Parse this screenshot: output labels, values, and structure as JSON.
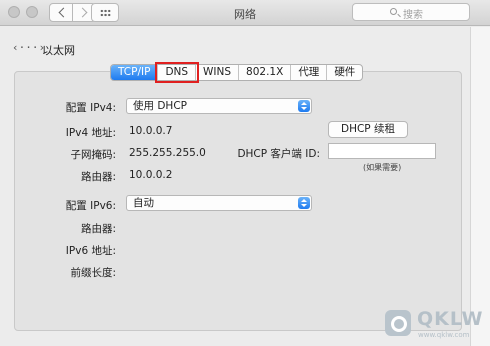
{
  "window": {
    "title": "网络"
  },
  "search": {
    "placeholder": "搜索"
  },
  "interface": {
    "name": "以太网",
    "icon": "ethernet-arrows-icon",
    "icon_glyph": "‹···›"
  },
  "tabs": [
    {
      "label": "TCP/IP",
      "active": true
    },
    {
      "label": "DNS",
      "highlighted": true
    },
    {
      "label": "WINS"
    },
    {
      "label": "802.1X"
    },
    {
      "label": "代理"
    },
    {
      "label": "硬件"
    }
  ],
  "ipv4": {
    "config_label": "配置 IPv4:",
    "config_value": "使用 DHCP",
    "address_label": "IPv4 地址:",
    "address_value": "10.0.0.7",
    "subnet_label": "子网掩码:",
    "subnet_value": "255.255.255.0",
    "router_label": "路由器:",
    "router_value": "10.0.0.2"
  },
  "dhcp": {
    "renew_label": "DHCP 续租",
    "client_id_label": "DHCP 客户端 ID:",
    "client_id_value": "",
    "client_id_hint": "(如果需要)"
  },
  "ipv6": {
    "config_label": "配置 IPv6:",
    "config_value": "自动",
    "router_label": "路由器:",
    "address_label": "IPv6 地址:",
    "prefix_label": "前缀长度:"
  },
  "watermark": {
    "text": "QKLW",
    "sub": "www.qklw.com"
  },
  "colors": {
    "accent": "#1e7bf0",
    "highlight_box": "#e02020"
  }
}
